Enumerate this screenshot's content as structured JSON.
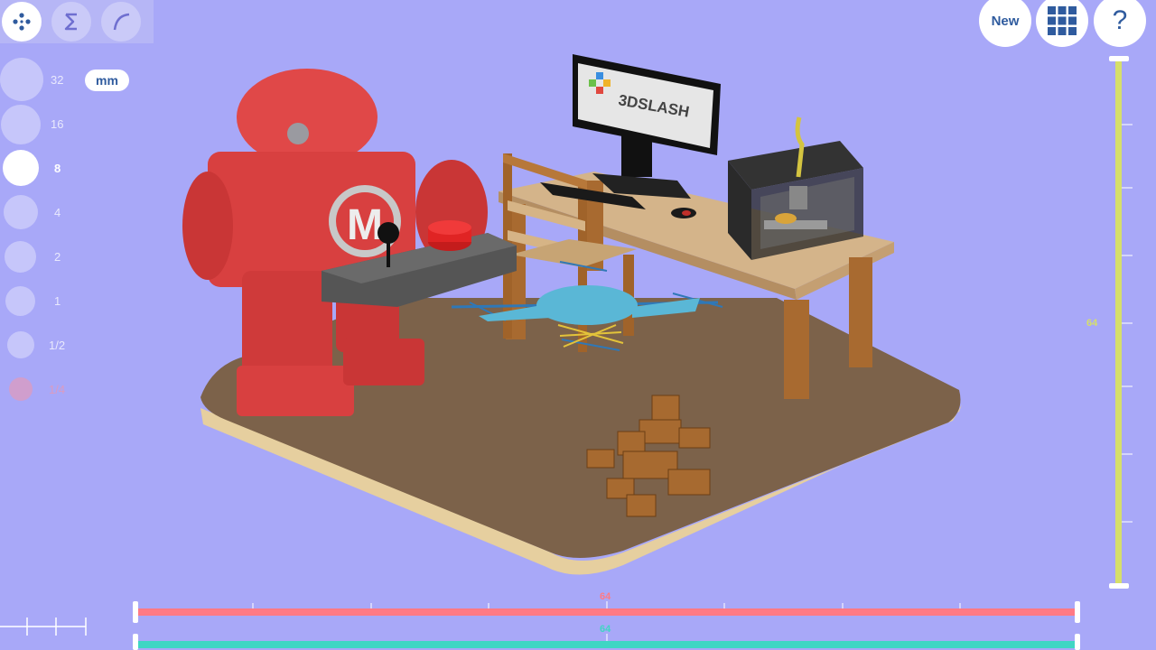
{
  "toolbar": {
    "tools": [
      {
        "name": "dots-tool",
        "state": "active"
      },
      {
        "name": "sigma-tool",
        "state": "inactive"
      },
      {
        "name": "curve-tool",
        "state": "inactive"
      }
    ]
  },
  "brush_sizes": {
    "options": [
      "32",
      "16",
      "8",
      "4",
      "2",
      "1",
      "1/2",
      "1/4"
    ],
    "selected": "8",
    "disabled": "1/4",
    "unit_label": "mm"
  },
  "top_right": {
    "new_label": "New",
    "grid_icon": "grid-icon",
    "help_label": "?"
  },
  "scene": {
    "monitor_text": "3DSLASH",
    "robot_badge": "M"
  },
  "axes": {
    "vertical_value": "64",
    "horizontal_red_value": "64",
    "horizontal_teal_value": "64"
  },
  "colors": {
    "background": "#a8a8f8",
    "vertical_slider": "#d6df6a",
    "red_slider": "#ff7a85",
    "teal_slider": "#3fd6c4",
    "accent_text": "#2f5b9e"
  }
}
